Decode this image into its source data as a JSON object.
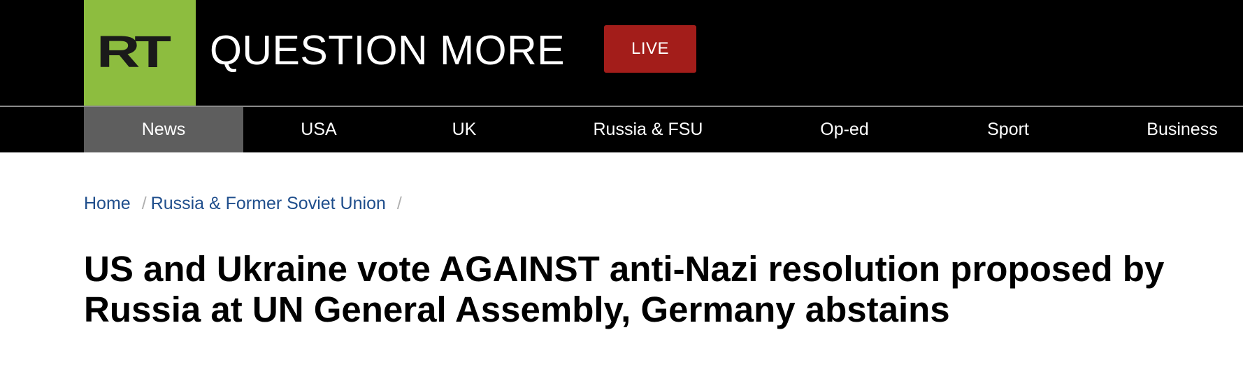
{
  "header": {
    "logo_text": "RT",
    "tagline": "QUESTION MORE",
    "live_label": "LIVE"
  },
  "nav": {
    "items": [
      {
        "label": "News",
        "active": true
      },
      {
        "label": "USA",
        "active": false
      },
      {
        "label": "UK",
        "active": false
      },
      {
        "label": "Russia & FSU",
        "active": false
      },
      {
        "label": "Op-ed",
        "active": false
      },
      {
        "label": "Sport",
        "active": false
      },
      {
        "label": "Business",
        "active": false
      }
    ]
  },
  "breadcrumb": {
    "items": [
      "Home",
      "Russia & Former Soviet Union"
    ],
    "separator": "/"
  },
  "article": {
    "headline": "US and Ukraine vote AGAINST anti-Nazi resolution proposed by Russia at UN General Assembly, Germany abstains"
  },
  "colors": {
    "brand_green": "#8dbd3f",
    "live_red": "#a31d1a",
    "nav_active": "#5e5e5e",
    "link_blue": "#1f4e8c"
  }
}
